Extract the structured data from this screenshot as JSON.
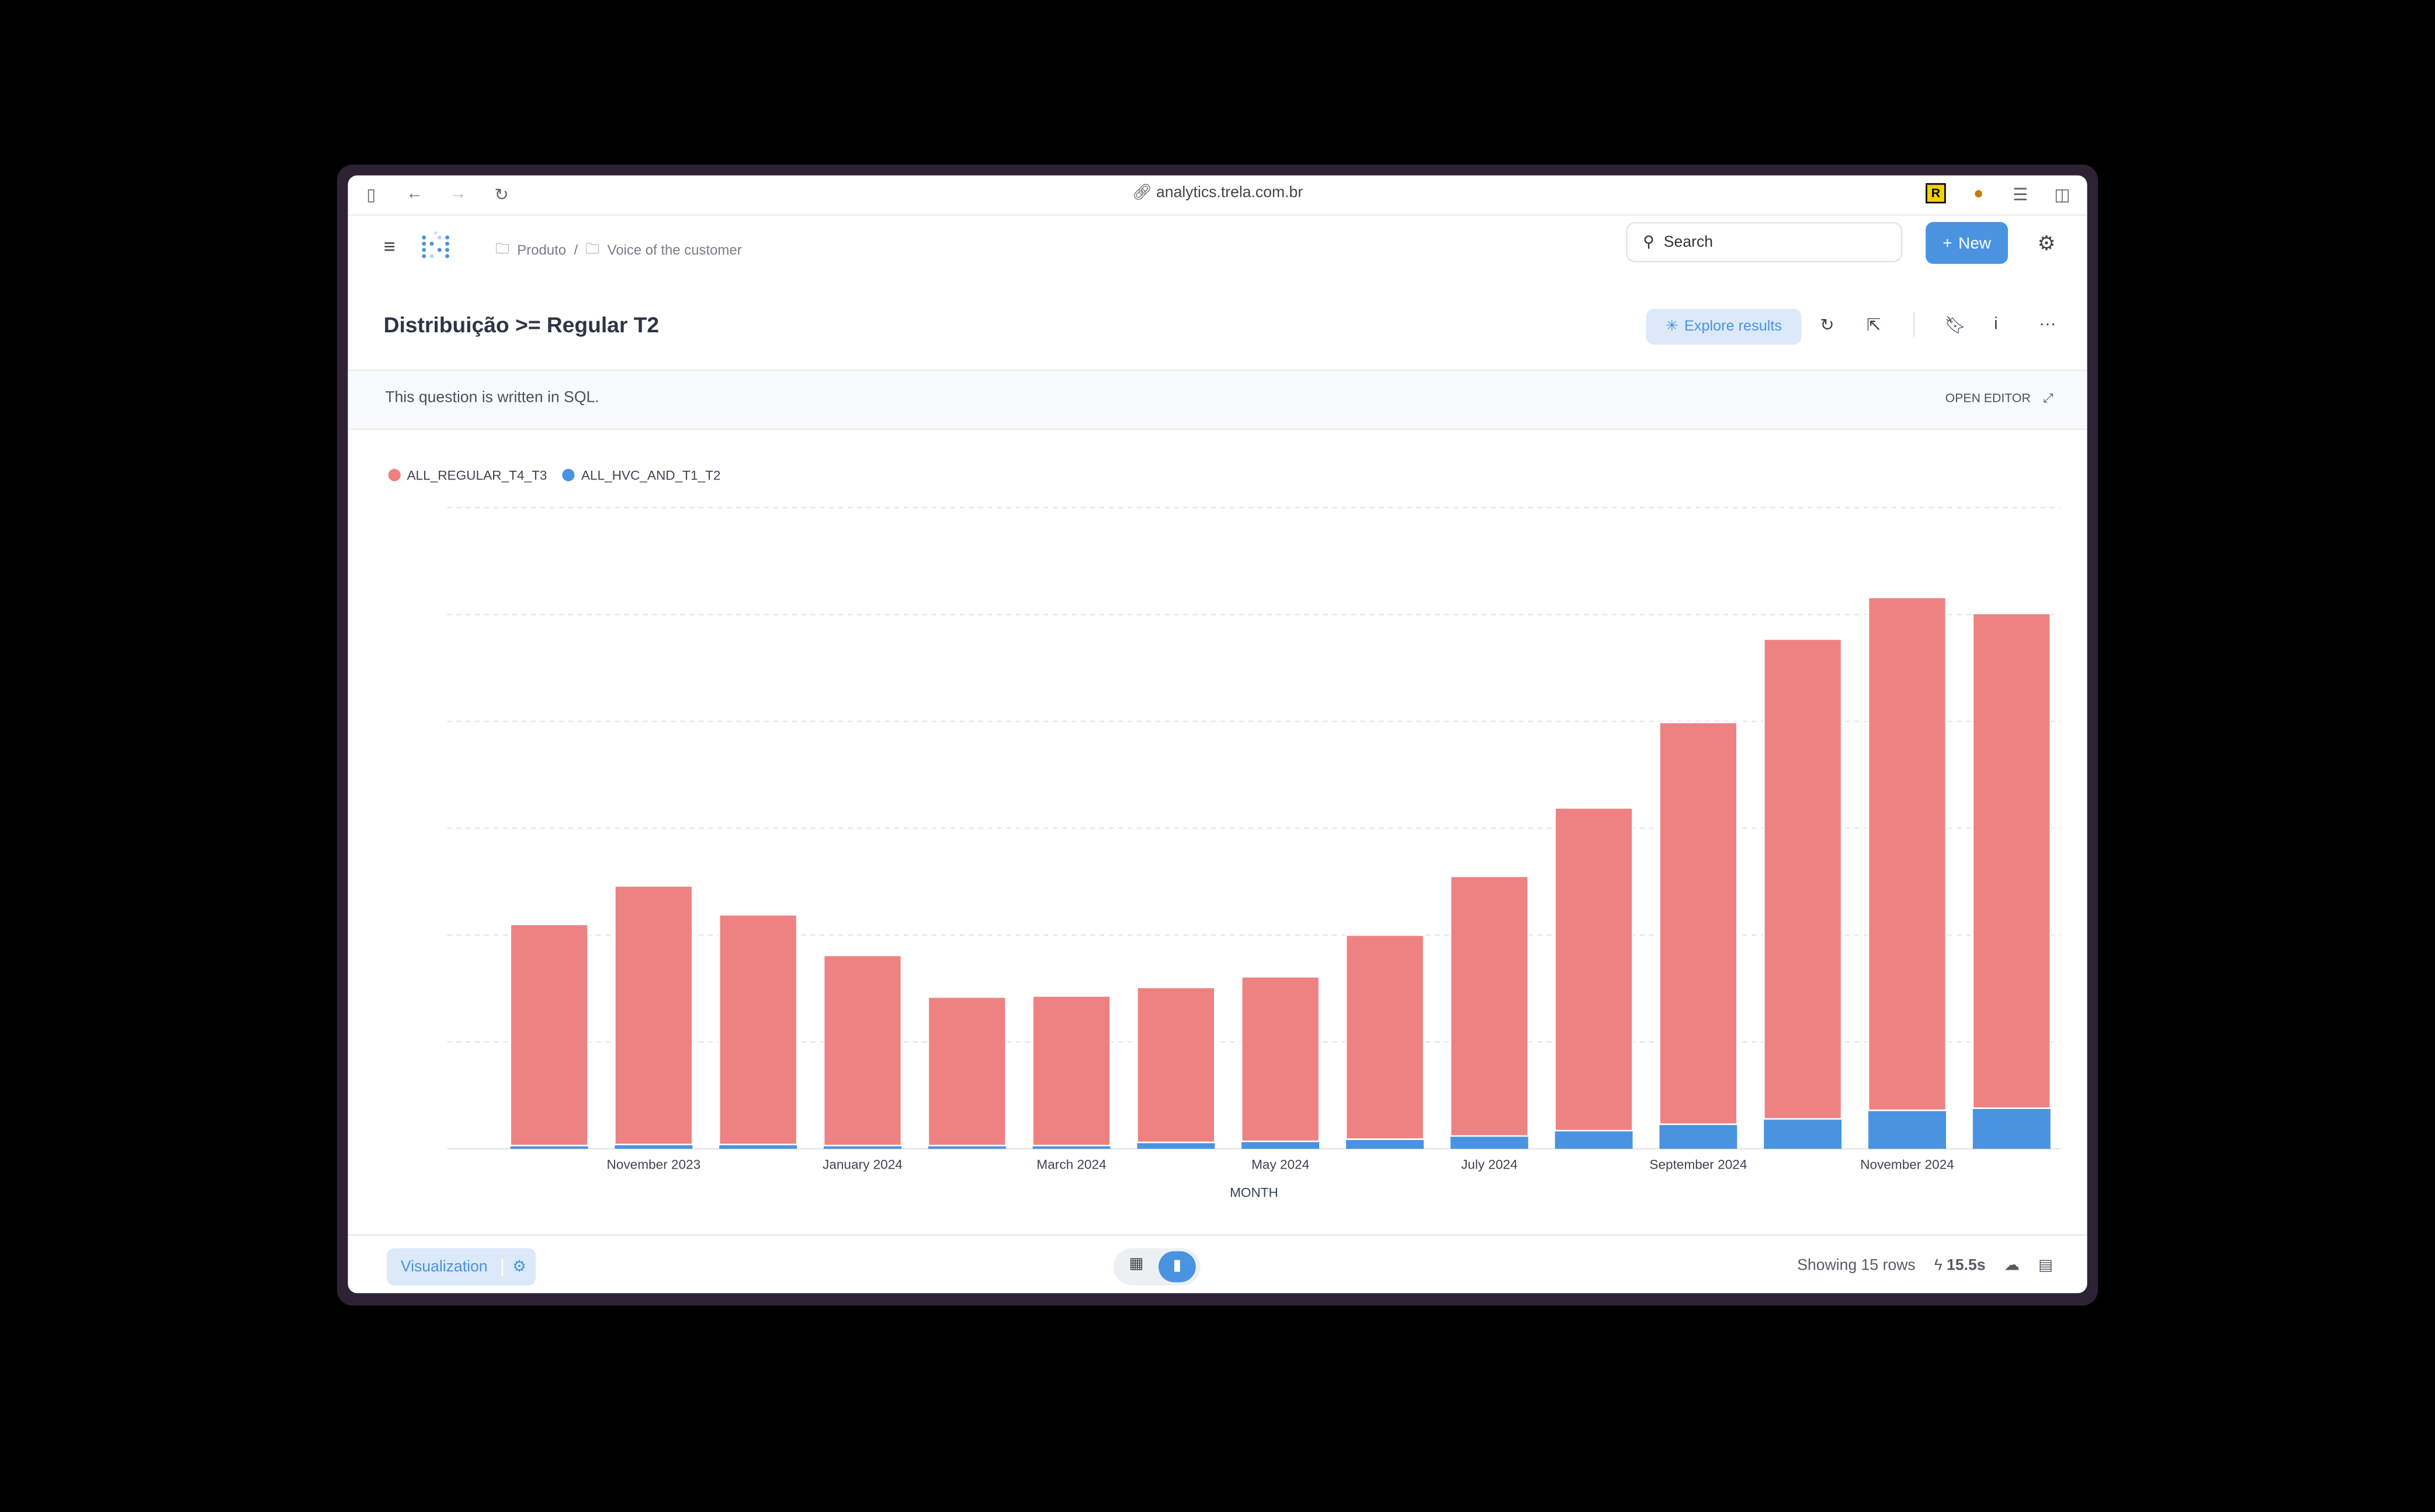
{
  "browser": {
    "url": "analytics.trela.com.br",
    "icons": [
      "sidebar-toggle-icon",
      "back-icon",
      "forward-icon",
      "reload-icon",
      "link-icon",
      "extension-r-icon",
      "extension-bird-icon",
      "extension-list-icon",
      "split-view-icon"
    ]
  },
  "appbar": {
    "breadcrumb": [
      "Produto",
      "Voice of the customer"
    ],
    "search_placeholder": "Search",
    "new_label": "New"
  },
  "header": {
    "title": "Distribuição >= Regular T2",
    "explore_label": "Explore results"
  },
  "sql_bar": {
    "text": "This question is written in SQL.",
    "open_editor": "OPEN EDITOR"
  },
  "colors": {
    "accent": "#4a93e0",
    "series_regular": "#ee8282",
    "series_hvc": "#4a93e0"
  },
  "chart_data": {
    "type": "bar",
    "stacked": true,
    "categories": [
      "October 2023",
      "November 2023",
      "December 2023",
      "January 2024",
      "February 2024",
      "March 2024",
      "April 2024",
      "May 2024",
      "June 2024",
      "July 2024",
      "August 2024",
      "September 2024",
      "October 2024",
      "November 2024",
      "December 2024"
    ],
    "tick_labels": [
      "November 2023",
      "January 2024",
      "March 2024",
      "May 2024",
      "July 2024",
      "September 2024",
      "November 2024"
    ],
    "series": [
      {
        "name": "ALL_REGULAR_T4_T3",
        "color": "#ee8282",
        "values": [
          2.07,
          2.42,
          2.15,
          1.78,
          1.39,
          1.4,
          1.45,
          1.54,
          1.91,
          2.43,
          3.02,
          3.76,
          4.49,
          4.8,
          4.63
        ]
      },
      {
        "name": "ALL_HVC_AND_T1_T2",
        "color": "#4a93e0",
        "values": [
          0.03,
          0.04,
          0.04,
          0.03,
          0.03,
          0.03,
          0.06,
          0.07,
          0.09,
          0.12,
          0.17,
          0.23,
          0.28,
          0.36,
          0.38
        ]
      }
    ],
    "xlabel": "MONTH",
    "ylabel": "",
    "ylim": [
      0,
      6
    ],
    "grid": true,
    "legend": "top-left"
  },
  "footer": {
    "visualization_label": "Visualization",
    "rows_text": "Showing 15 rows",
    "duration": "15.5s"
  }
}
